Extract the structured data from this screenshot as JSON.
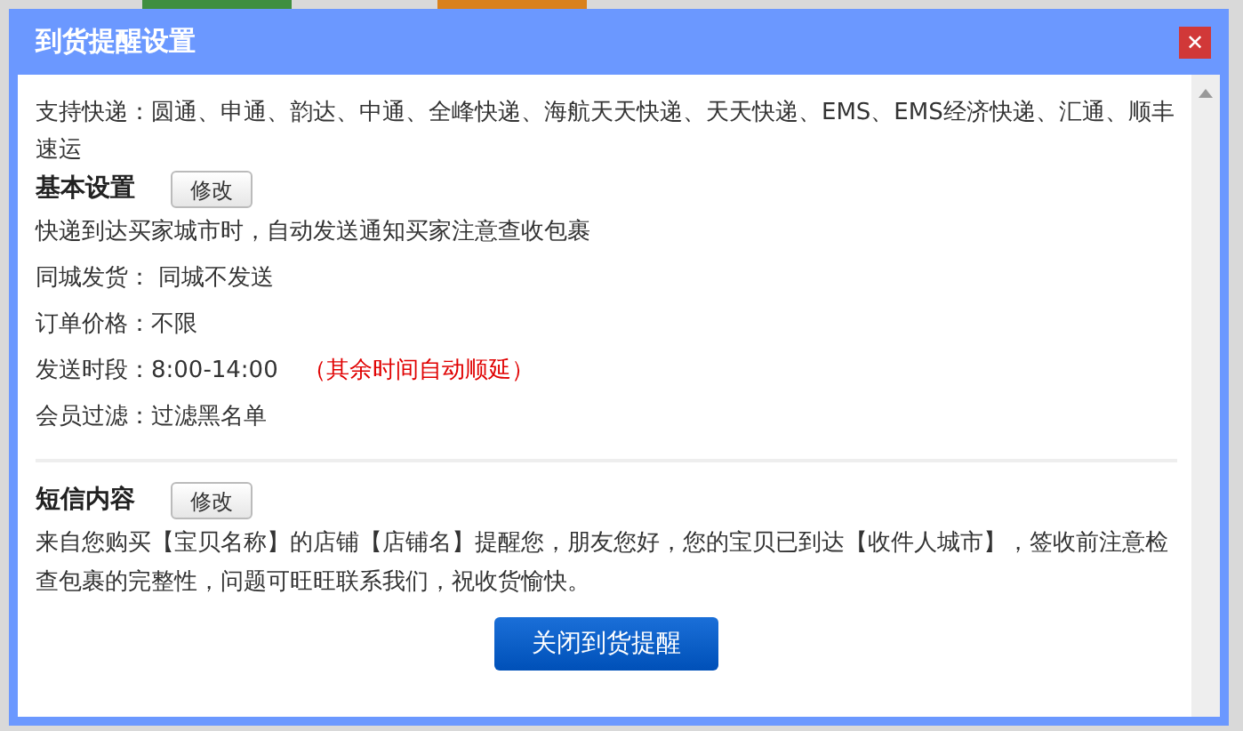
{
  "dialog": {
    "title": "到货提醒设置",
    "close": "✕",
    "express": "支持快递：圆通、申通、韵达、中通、全峰快递、海航天天快递、天天快递、EMS、EMS经济快递、汇通、顺丰速运",
    "sections": [
      {
        "title": "基本设置",
        "button": "修改",
        "lines": [
          {
            "text": "快递到达买家城市时，自动发送通知买家注意查收包裹"
          },
          {
            "text": "同城发货： 同城不发送"
          },
          {
            "text": "订单价格：不限"
          },
          {
            "text": "发送时段：8:00-14:00",
            "note": "（其余时间自动顺延）"
          },
          {
            "text": "会员过滤：过滤黑名单"
          }
        ]
      },
      {
        "title": "短信内容",
        "button": "修改",
        "lines": [
          {
            "text": "来自您购买【宝贝名称】的店铺【店铺名】提醒您，朋友您好，您的宝贝已到达【收件人城市】，签收前注意检查包裹的完整性，问题可旺旺联系我们，祝收货愉快。"
          }
        ]
      }
    ],
    "action_button": "关闭到货提醒"
  }
}
